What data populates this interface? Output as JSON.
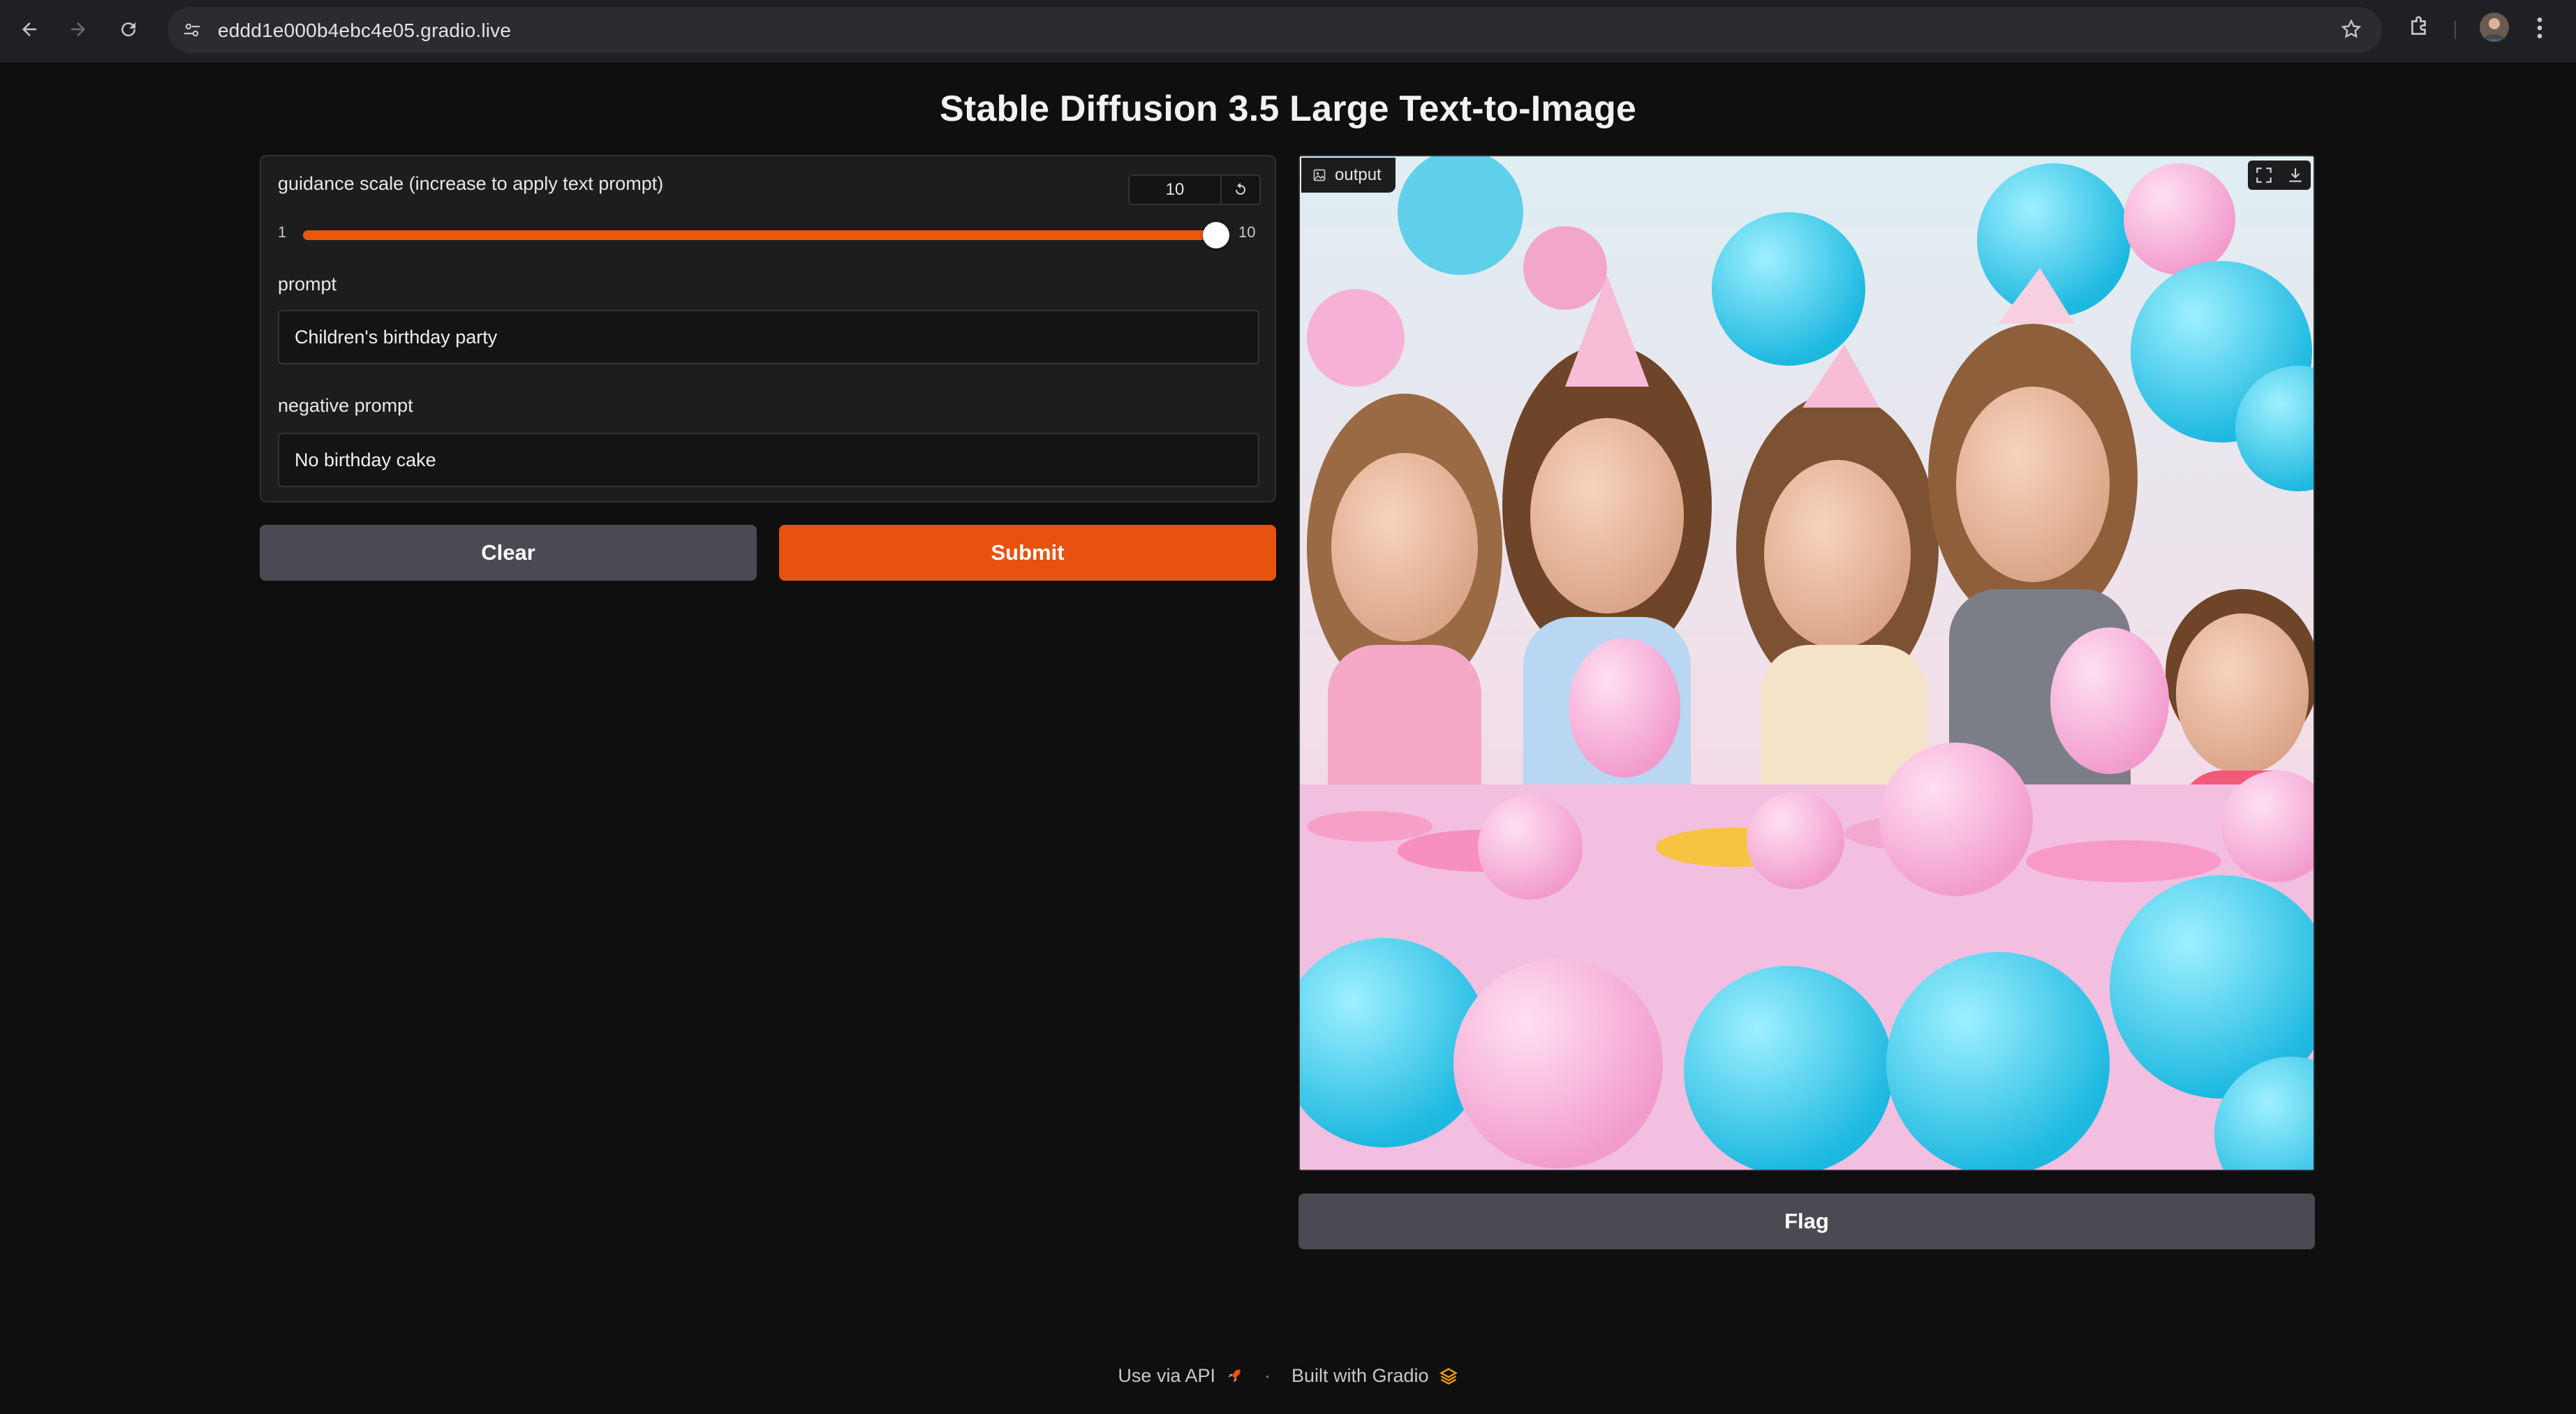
{
  "browser": {
    "url": "eddd1e000b4ebc4e05.gradio.live"
  },
  "page": {
    "title": "Stable Diffusion 3.5 Large Text-to-Image"
  },
  "guidance": {
    "label": "guidance scale (increase to apply text prompt)",
    "value": "10",
    "min": "1",
    "max": "10",
    "fraction": 1.0
  },
  "prompt": {
    "label": "prompt",
    "value": "Children's birthday party"
  },
  "negative_prompt": {
    "label": "negative prompt",
    "value": "No birthday cake"
  },
  "buttons": {
    "clear": "Clear",
    "submit": "Submit",
    "flag": "Flag"
  },
  "output": {
    "label": "output"
  },
  "footer": {
    "api": "Use via API",
    "separator": "·",
    "built": "Built with Gradio"
  },
  "colors": {
    "accent": "#e8520f",
    "background": "#0f0f10",
    "panel": "#1d1d20"
  }
}
